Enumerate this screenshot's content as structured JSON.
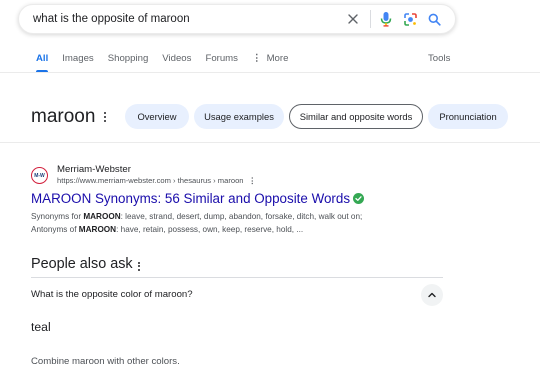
{
  "search": {
    "query": "what is the opposite of maroon"
  },
  "tabs": [
    {
      "label": "All",
      "active": true
    },
    {
      "label": "Images"
    },
    {
      "label": "Shopping"
    },
    {
      "label": "Videos"
    },
    {
      "label": "Forums"
    },
    {
      "label": "More"
    }
  ],
  "tools_label": "Tools",
  "knowledge_panel": {
    "title": "maroon",
    "chips": [
      "Overview",
      "Usage examples",
      "Similar and opposite words",
      "Pronunciation"
    ],
    "selected_chip": "Similar and opposite words"
  },
  "result": {
    "favicon_text": "M-W",
    "site_name": "Merriam-Webster",
    "url": "https://www.merriam-webster.com › thesaurus › maroon",
    "title": "MAROON Synonyms: 56 Similar and Opposite Words",
    "synonyms_prefix": "Synonyms for ",
    "synonyms_term": "MAROON",
    "synonyms_rest": ": leave, strand, desert, dump, abandon, forsake, ditch, walk out on;",
    "antonyms_prefix": "Antonyms of ",
    "antonyms_term": "MAROON",
    "antonyms_rest": ": have, retain, possess, own, keep, reserve, hold, ..."
  },
  "people_also_ask": {
    "title": "People also ask",
    "question": "What is the opposite color of maroon?",
    "answer": "teal",
    "followup": "Combine maroon with other colors."
  },
  "colors": {
    "link": "#1a0dab",
    "accent": "#1a73e8",
    "chip_bg": "#e8f0fe",
    "verified": "#34a853"
  }
}
